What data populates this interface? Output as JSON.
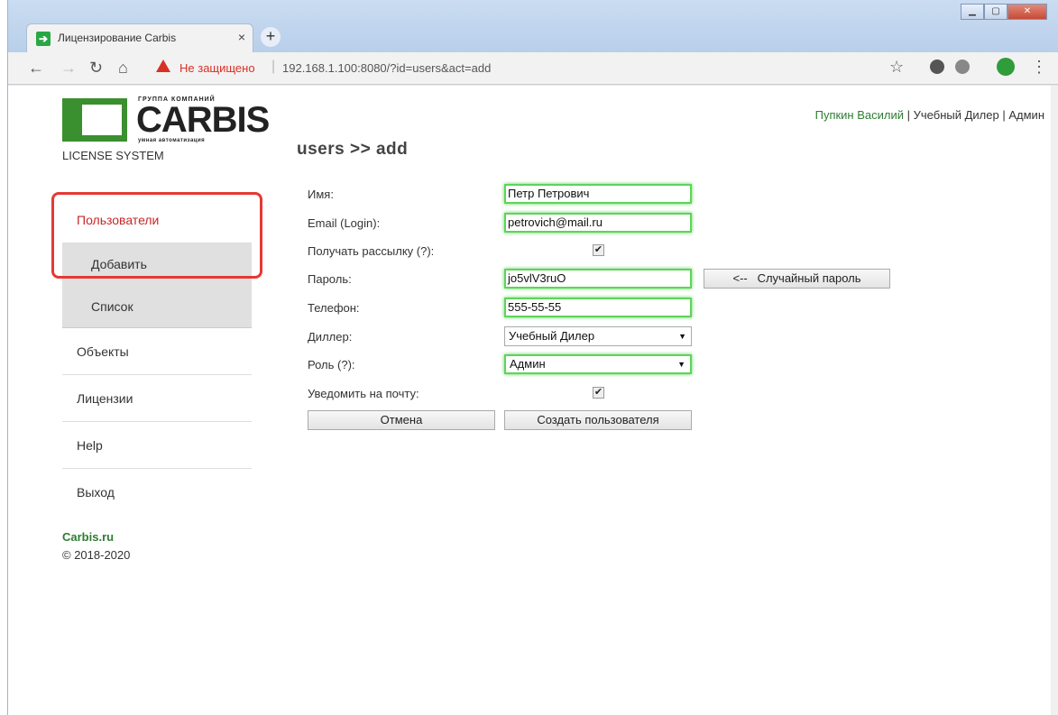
{
  "browser": {
    "tab_title": "Лицензирование Carbis",
    "tab_close": "×",
    "new_tab": "+",
    "security_warning": "Не защищено",
    "url": "192.168.1.100:8080/?id=users&act=add"
  },
  "header": {
    "logo_top": "ГРУППА КОМПАНИЙ",
    "logo_name": "CARBIS",
    "logo_sub": "умная автоматизация",
    "license_system": "LICENSE SYSTEM",
    "user_name": "Пупкин Василий",
    "separator": "|",
    "dealer": "Учебный Дилер",
    "role": "Админ",
    "page_title": "users >> add"
  },
  "sidebar": {
    "users": "Пользователи",
    "add": "Добавить",
    "list": "Список",
    "objects": "Объекты",
    "licenses": "Лицензии",
    "help": "Help",
    "logout": "Выход"
  },
  "footer": {
    "site": "Carbis.ru",
    "copyright": "© 2018-2020"
  },
  "form": {
    "name_label": "Имя:",
    "name_value": "Петр Петрович",
    "email_label": "Email (Login):",
    "email_value": "petrovich@mail.ru",
    "newsletter_label": "Получать рассылку (?):",
    "password_label": "Пароль:",
    "password_value": "jo5vlV3ruO",
    "random_password_button": "<--   Случайный пароль",
    "phone_label": "Телефон:",
    "phone_value": "555-55-55",
    "dealer_label": "Диллер:",
    "dealer_value": "Учебный Дилер",
    "role_label": "Роль (?):",
    "role_value": "Админ",
    "notify_label": "Уведомить на почту:",
    "cancel_button": "Отмена",
    "create_button": "Создать пользователя",
    "check_mark": "✔"
  }
}
